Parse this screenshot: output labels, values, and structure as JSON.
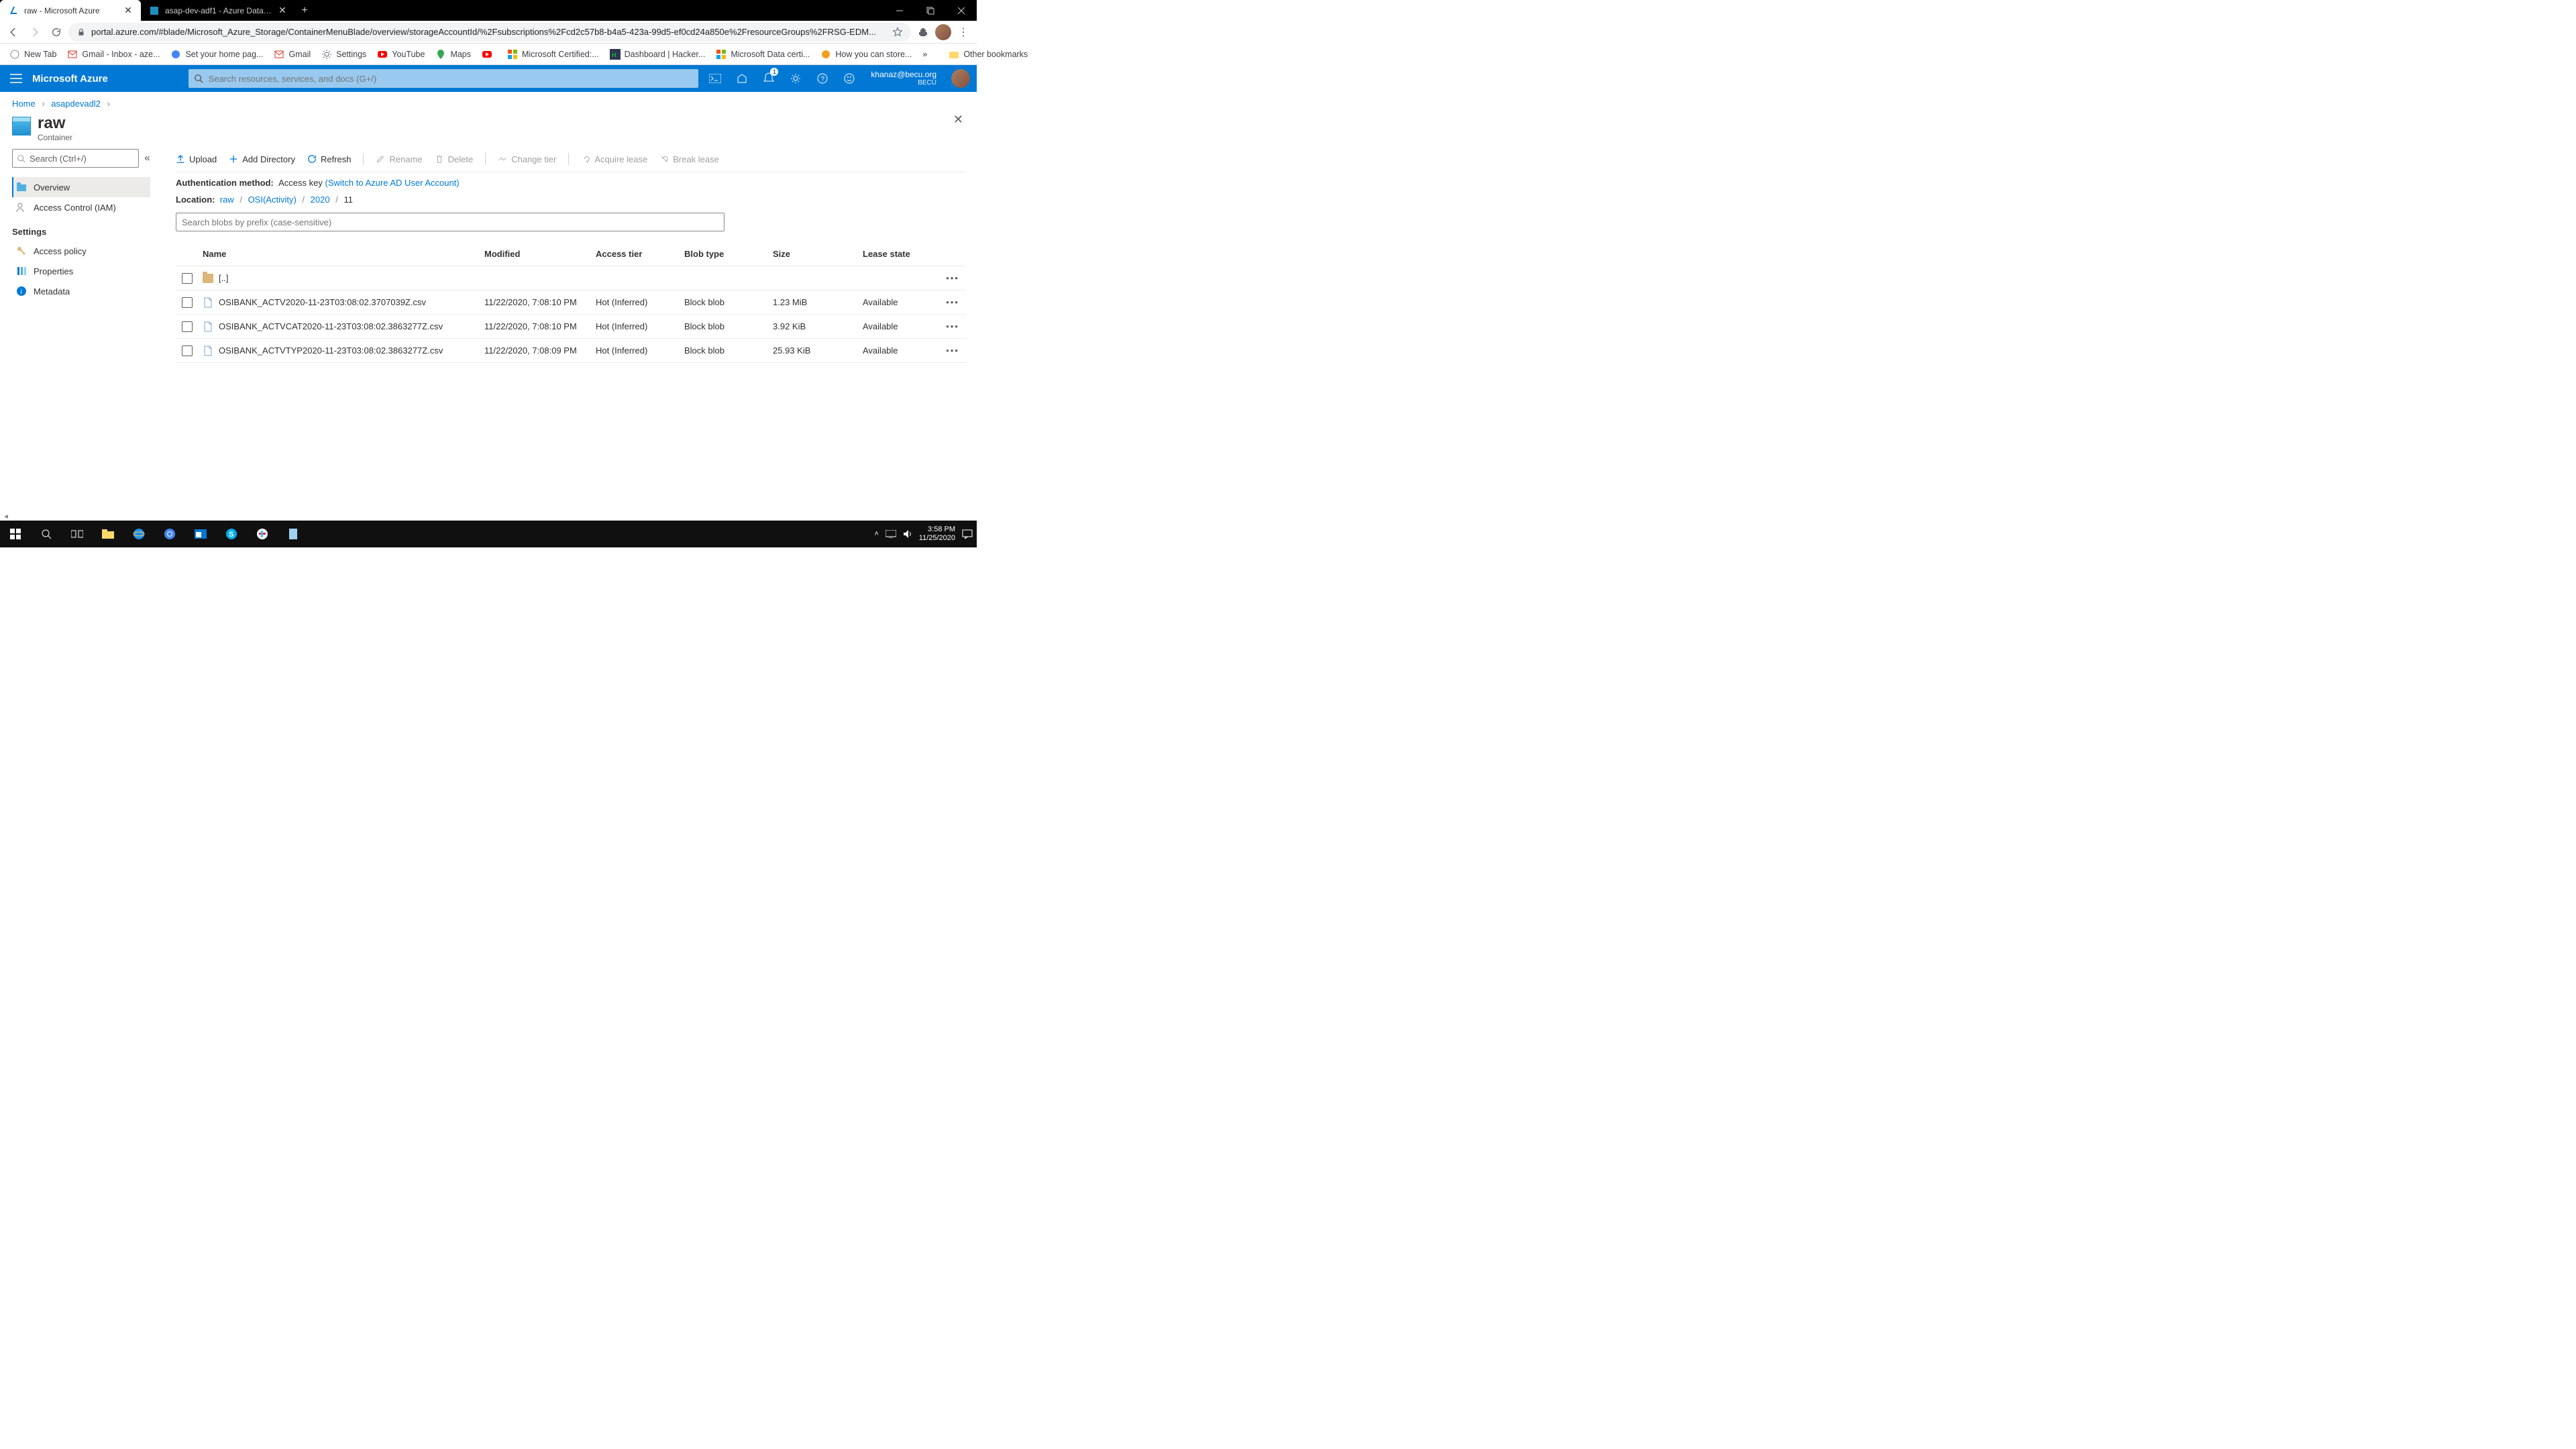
{
  "chrome": {
    "tabs": [
      {
        "title": "raw - Microsoft Azure"
      },
      {
        "title": "asap-dev-adf1 - Azure Data Factory"
      }
    ],
    "url": "portal.azure.com/#blade/Microsoft_Azure_Storage/ContainerMenuBlade/overview/storageAccountId/%2Fsubscriptions%2Fcd2c57b8-b4a5-423a-99d5-ef0cd24a850e%2FresourceGroups%2FRSG-EDM...",
    "bookmarks": [
      "New Tab",
      "Gmail - Inbox - aze...",
      "Set your home pag...",
      "Gmail",
      "Settings",
      "YouTube",
      "Maps",
      "",
      "Microsoft Certified:...",
      "Dashboard | Hacker...",
      "Microsoft Data certi...",
      "How you can store..."
    ],
    "more": "»",
    "other": "Other bookmarks"
  },
  "azure": {
    "brand": "Microsoft Azure",
    "searchPlaceholder": "Search resources, services, and docs (G+/)",
    "notif": "1",
    "email": "khanaz@becu.org",
    "org": "BECU"
  },
  "crumbs": {
    "home": "Home",
    "parent": "asapdevadl2"
  },
  "pane": {
    "title": "raw",
    "sub": "Container"
  },
  "left": {
    "search": "Search (Ctrl+/)",
    "items": [
      "Overview",
      "Access Control (IAM)"
    ],
    "settingsHead": "Settings",
    "settings": [
      "Access policy",
      "Properties",
      "Metadata"
    ]
  },
  "toolbar": {
    "upload": "Upload",
    "adddir": "Add Directory",
    "refresh": "Refresh",
    "rename": "Rename",
    "delete": "Delete",
    "changetier": "Change tier",
    "acquire": "Acquire lease",
    "break": "Break lease"
  },
  "auth": {
    "label": "Authentication method:",
    "value": "Access key",
    "switch": "(Switch to Azure AD User Account)"
  },
  "loc": {
    "label": "Location:",
    "p1": "raw",
    "p2": "OSI(Activity)",
    "p3": "2020",
    "p4": "11"
  },
  "blobSearchPlaceholder": "Search blobs by prefix (case-sensitive)",
  "cols": {
    "name": "Name",
    "modified": "Modified",
    "tier": "Access tier",
    "type": "Blob type",
    "size": "Size",
    "lease": "Lease state"
  },
  "rows": [
    {
      "name": "[..]",
      "folder": true
    },
    {
      "name": "OSIBANK_ACTV2020-11-23T03:08:02.3707039Z.csv",
      "modified": "11/22/2020, 7:08:10 PM",
      "tier": "Hot (Inferred)",
      "type": "Block blob",
      "size": "1.23 MiB",
      "lease": "Available"
    },
    {
      "name": "OSIBANK_ACTVCAT2020-11-23T03:08:02.3863277Z.csv",
      "modified": "11/22/2020, 7:08:10 PM",
      "tier": "Hot (Inferred)",
      "type": "Block blob",
      "size": "3.92 KiB",
      "lease": "Available"
    },
    {
      "name": "OSIBANK_ACTVTYP2020-11-23T03:08:02.3863277Z.csv",
      "modified": "11/22/2020, 7:08:09 PM",
      "tier": "Hot (Inferred)",
      "type": "Block blob",
      "size": "25.93 KiB",
      "lease": "Available"
    }
  ],
  "sys": {
    "time": "3:58 PM",
    "date": "11/25/2020"
  }
}
